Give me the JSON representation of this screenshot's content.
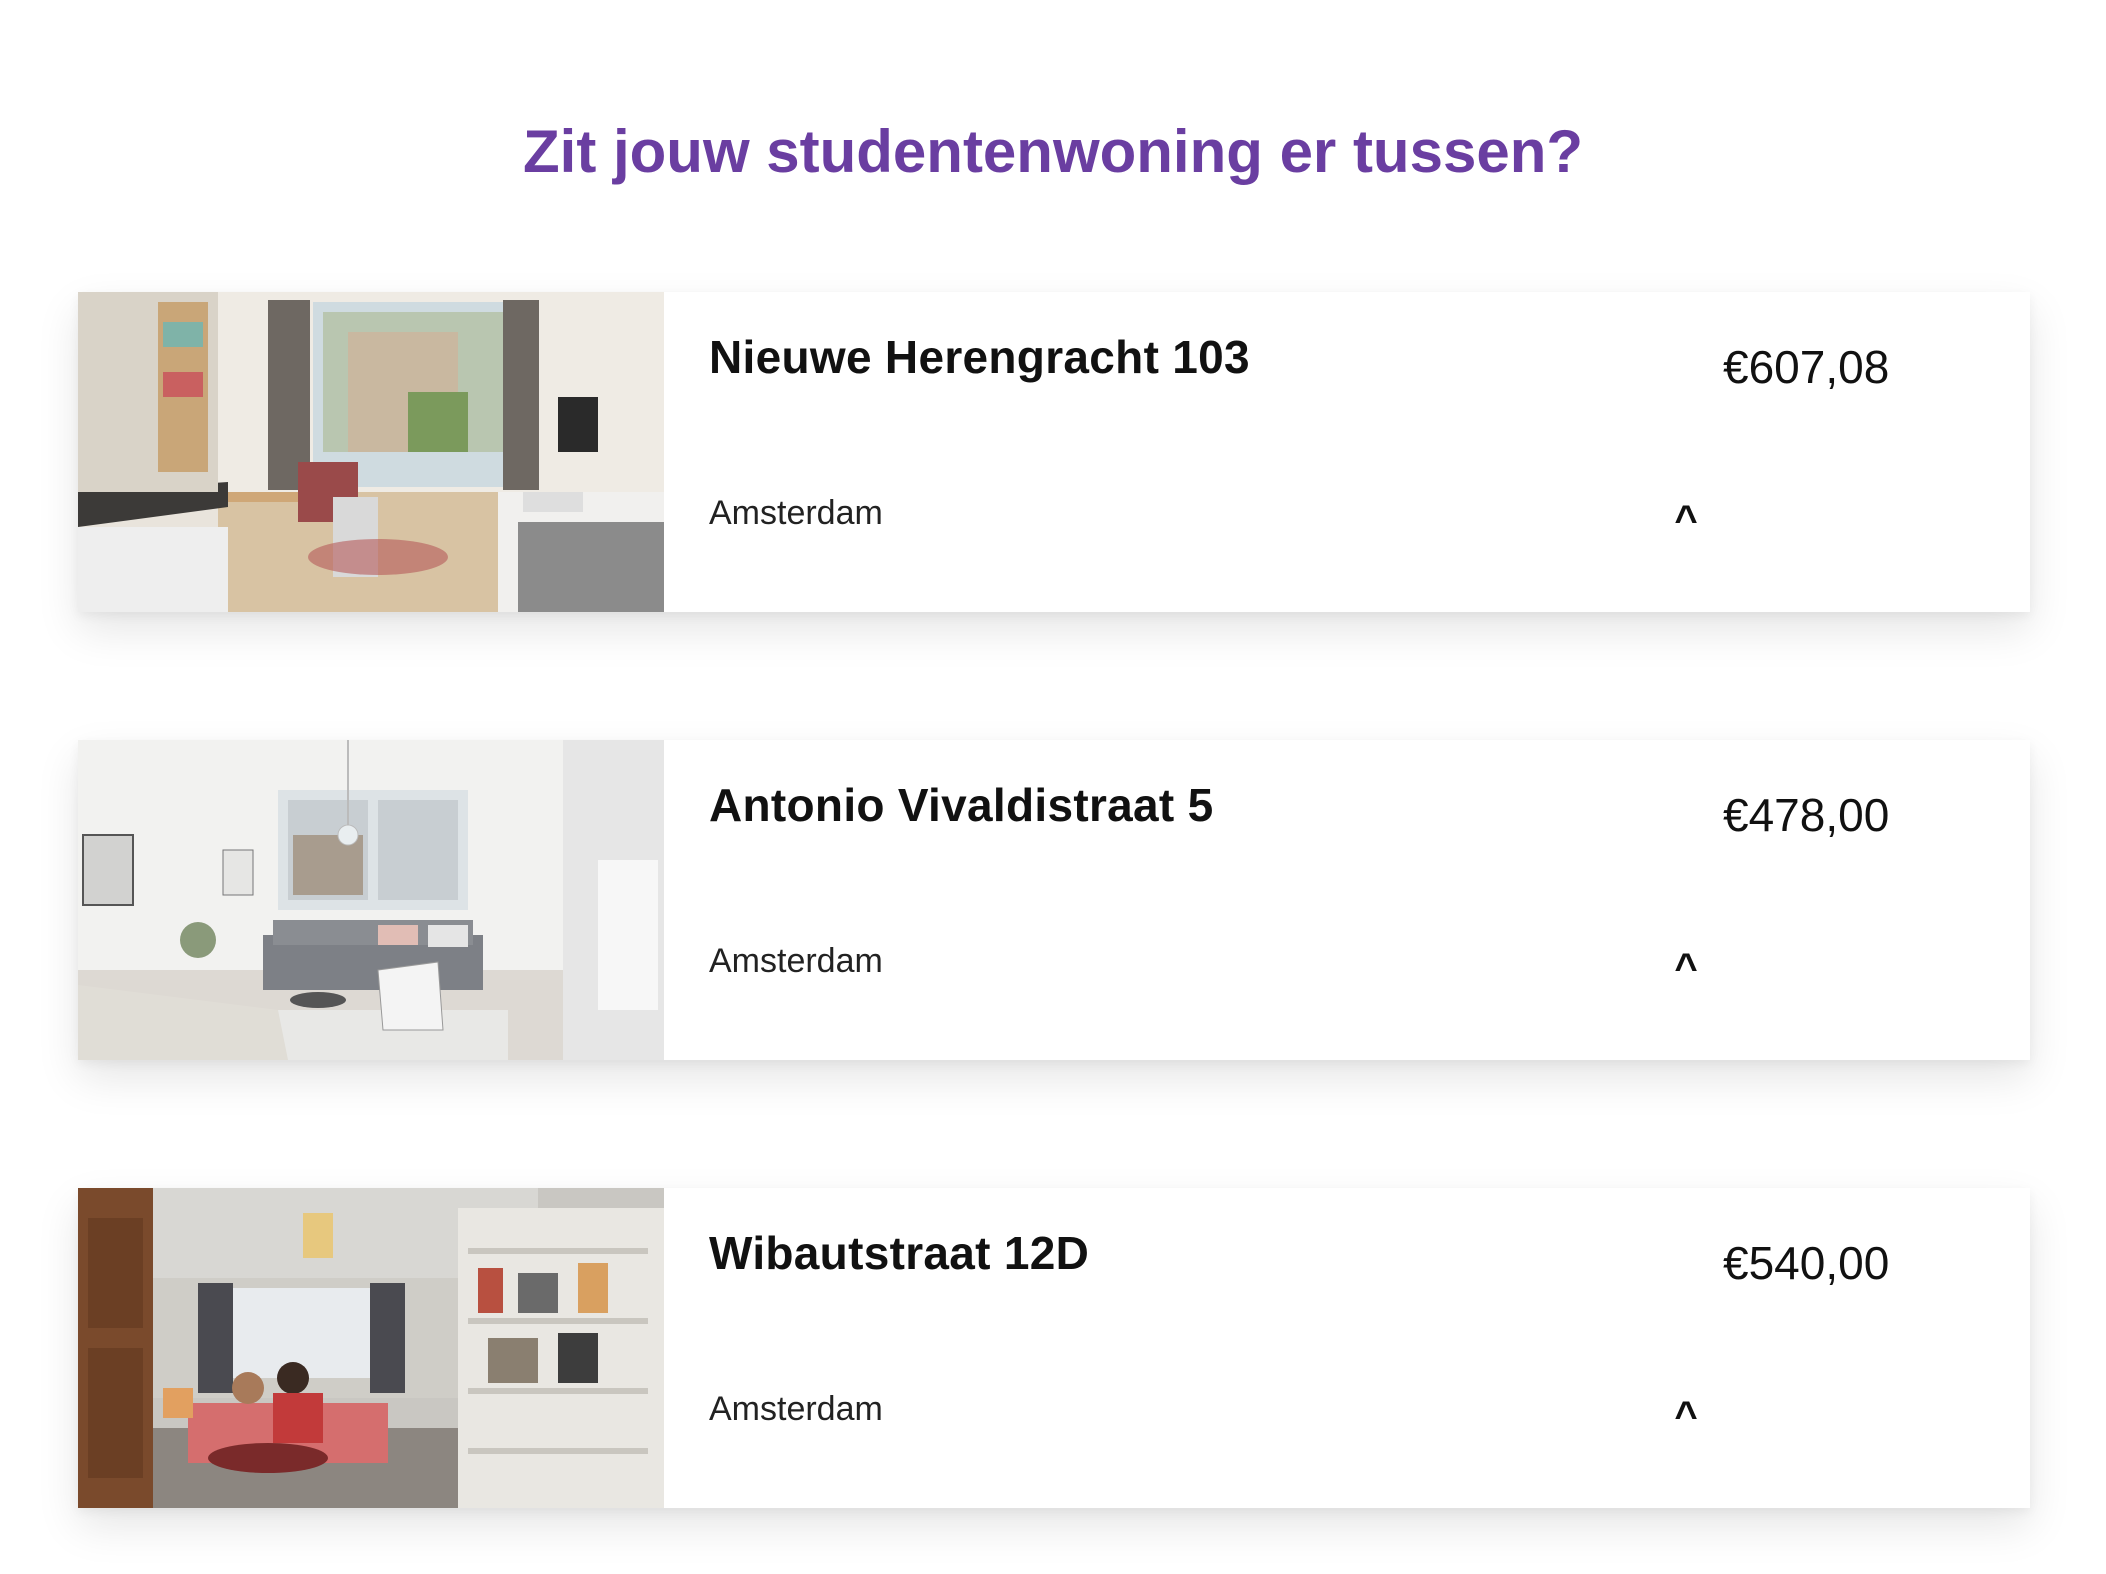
{
  "heading": "Zit jouw studentenwoning er tussen?",
  "listings": [
    {
      "title": "Nieuwe Herengracht 103",
      "city": "Amsterdam",
      "price": "€607,08",
      "toggle_icon": "^"
    },
    {
      "title": "Antonio Vivaldistraat 5",
      "city": "Amsterdam",
      "price": "€478,00",
      "toggle_icon": "^"
    },
    {
      "title": "Wibautstraat 12D",
      "city": "Amsterdam",
      "price": "€540,00",
      "toggle_icon": "^"
    }
  ],
  "colors": {
    "heading": "#6a3ea1",
    "text": "#111111",
    "card_background": "#ffffff"
  }
}
